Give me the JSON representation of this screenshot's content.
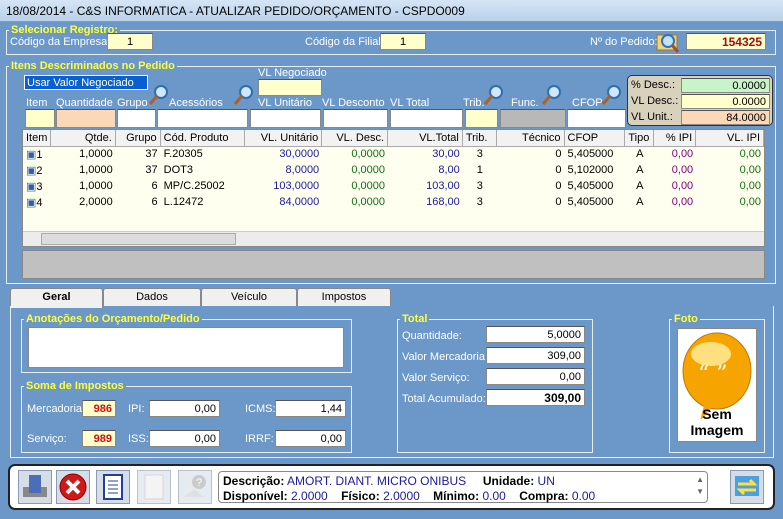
{
  "window": {
    "title": "18/08/2014  -  C&S INFORMATICA  -  ATUALIZAR PEDIDO/ORÇAMENTO  -  CSPDO009"
  },
  "selecionar": {
    "legend": "Selecionar Registro:",
    "empresa_label": "Código da Empresa:",
    "empresa": "1",
    "filial_label": "Código da Filial:",
    "filial": "1",
    "pedido_label": "Nº do Pedido:",
    "pedido": "154325"
  },
  "itens": {
    "legend": "Itens Descriminados no Pedido",
    "dropdown": "Usar Valor Negociado",
    "vl_negociado_label": "VL Negociado",
    "field_labels": {
      "item": "Item",
      "quantidade": "Quantidade",
      "grupo": "Grupo",
      "acessorios": "Acessórios",
      "vl_unitario": "VL Unitário",
      "vl_desconto": "VL Desconto",
      "vl_total": "VL Total",
      "trib": "Trib.",
      "func": "Func.",
      "cfop": "CFOP"
    },
    "summary": {
      "desc_pct_label": "% Desc.:",
      "desc_pct": "0.0000",
      "vl_desc_label": "VL Desc.:",
      "vl_desc": "0.0000",
      "vl_unit_label": "VL Unit.:",
      "vl_unit": "84.0000"
    }
  },
  "grid": {
    "columns": [
      "Item",
      "Qtde.",
      "Grupo",
      "Cód. Produto",
      "VL. Unitário",
      "VL. Desc.",
      "VL.Total",
      "Trib.",
      "Técnico",
      "CFOP",
      "Tipo",
      "% IPI",
      "VL. IPI"
    ],
    "rows": [
      [
        "1",
        "1,0000",
        "37",
        "F.20305",
        "30,0000",
        "0,0000",
        "30,00",
        "3",
        "0",
        "5,405000",
        "A",
        "0,00",
        "0,00"
      ],
      [
        "2",
        "1,0000",
        "37",
        "DOT3",
        "8,0000",
        "0,0000",
        "8,00",
        "1",
        "0",
        "5,102000",
        "A",
        "0,00",
        "0,00"
      ],
      [
        "3",
        "1,0000",
        "6",
        "MP/C.25002",
        "103,0000",
        "0,0000",
        "103,00",
        "3",
        "0",
        "5,405000",
        "A",
        "0,00",
        "0,00"
      ],
      [
        "4",
        "2,0000",
        "6",
        "L.12472",
        "84,0000",
        "0,0000",
        "168,00",
        "3",
        "0",
        "5,405000",
        "A",
        "0,00",
        "0,00"
      ]
    ]
  },
  "tabs": [
    "Geral",
    "Dados",
    "Veículo",
    "Impostos"
  ],
  "anotacoes": {
    "legend": "Anotações do Orçamento/Pedido",
    "value": ""
  },
  "impostos": {
    "legend": "Soma de Impostos",
    "mercadoria_label": "Mercadoria:",
    "mercadoria": "986",
    "servico_label": "Serviço:",
    "servico": "989",
    "ipi_label": "IPI:",
    "ipi": "0,00",
    "iss_label": "ISS:",
    "iss": "0,00",
    "icms_label": "ICMS:",
    "icms": "1,44",
    "irrf_label": "IRRF:",
    "irrf": "0,00"
  },
  "total": {
    "legend": "Total",
    "quantidade_label": "Quantidade:",
    "quantidade": "5,0000",
    "mercadoria_label": "Valor Mercadoria:",
    "mercadoria": "309,00",
    "servico_label": "Valor Serviço:",
    "servico": "0,00",
    "acumulado_label": "Total Acumulado:",
    "acumulado": "309,00"
  },
  "foto": {
    "legend": "Foto",
    "placeholder": "Sem Imagem"
  },
  "status": {
    "descricao_label": "Descrição:",
    "descricao": "AMORT. DIANT. MICRO ONIBUS",
    "unidade_label": "Unidade:",
    "unidade": "UN",
    "disponivel_label": "Disponível:",
    "disponivel": "2.0000",
    "fisico_label": "Físico:",
    "fisico": "2.0000",
    "minimo_label": "Mínimo:",
    "minimo": "0.00",
    "compra_label": "Compra:",
    "compra": "0.00"
  }
}
